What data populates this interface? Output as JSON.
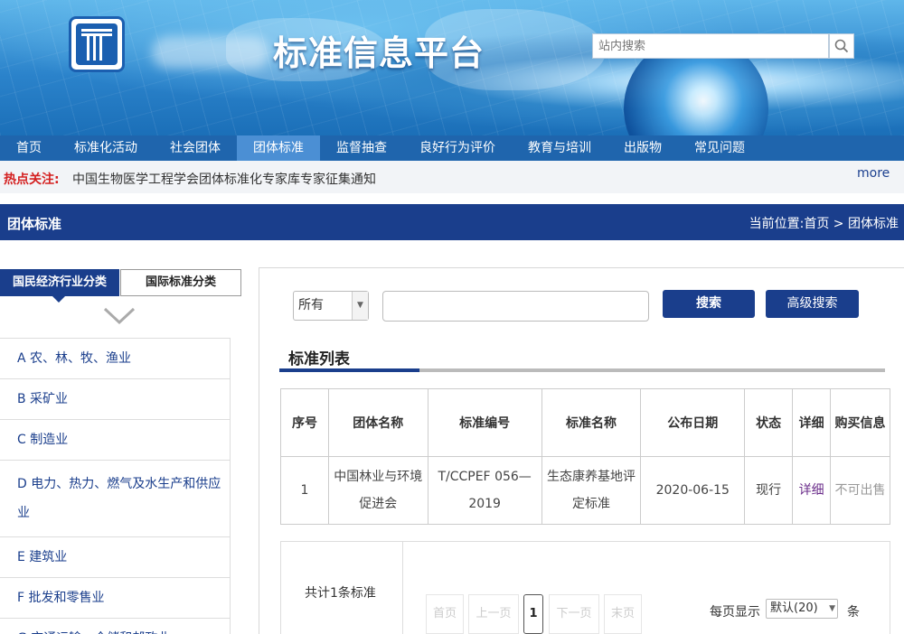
{
  "header": {
    "site_title": "标准信息平台",
    "search_placeholder": "站内搜索"
  },
  "nav": {
    "items": [
      "首页",
      "标准化活动",
      "社会团体",
      "团体标准",
      "监督抽查",
      "良好行为评价",
      "教育与培训",
      "出版物",
      "常见问题"
    ],
    "active_index": 3
  },
  "hot": {
    "label": "热点关注:",
    "text": "中国生物医学工程学会团体标准化专家库专家征集通知",
    "more": "more"
  },
  "section": {
    "title": "团体标准",
    "breadcrumb": "当前位置:首页 > 团体标准"
  },
  "sidebar": {
    "tab_active": "国民经济行业分类",
    "tab_other": "国际标准分类",
    "categories": [
      "A 农、林、牧、渔业",
      "B 采矿业",
      "C 制造业",
      "D 电力、热力、燃气及水生产和供应业",
      "E 建筑业",
      "F 批发和零售业",
      "G 交通运输、仓储和邮政业"
    ]
  },
  "search": {
    "scope_value": "所有",
    "search_button": "搜索",
    "advanced_button": "高级搜索"
  },
  "list": {
    "title": "标准列表",
    "headers": [
      "序号",
      "团体名称",
      "标准编号",
      "标准名称",
      "公布日期",
      "状态",
      "详细",
      "购买信息"
    ],
    "rows": [
      {
        "index": "1",
        "org": "中国林业与环境促进会",
        "code": "T/CCPEF 056—2019",
        "name": "生态康养基地评定标准",
        "date": "2020-06-15",
        "status": "现行",
        "detail": "详细",
        "purchase": "不可出售"
      }
    ]
  },
  "pager": {
    "total": "共计1条标准",
    "first": "首页",
    "prev": "上一页",
    "current": "1",
    "next": "下一页",
    "last": "末页",
    "per_page_label": "每页显示",
    "per_page_value": "默认(20)",
    "unit": "条"
  },
  "colors": {
    "brand_navy": "#1a3e8c",
    "nav_blue": "#1f65ad",
    "hot_red": "#d42020"
  }
}
